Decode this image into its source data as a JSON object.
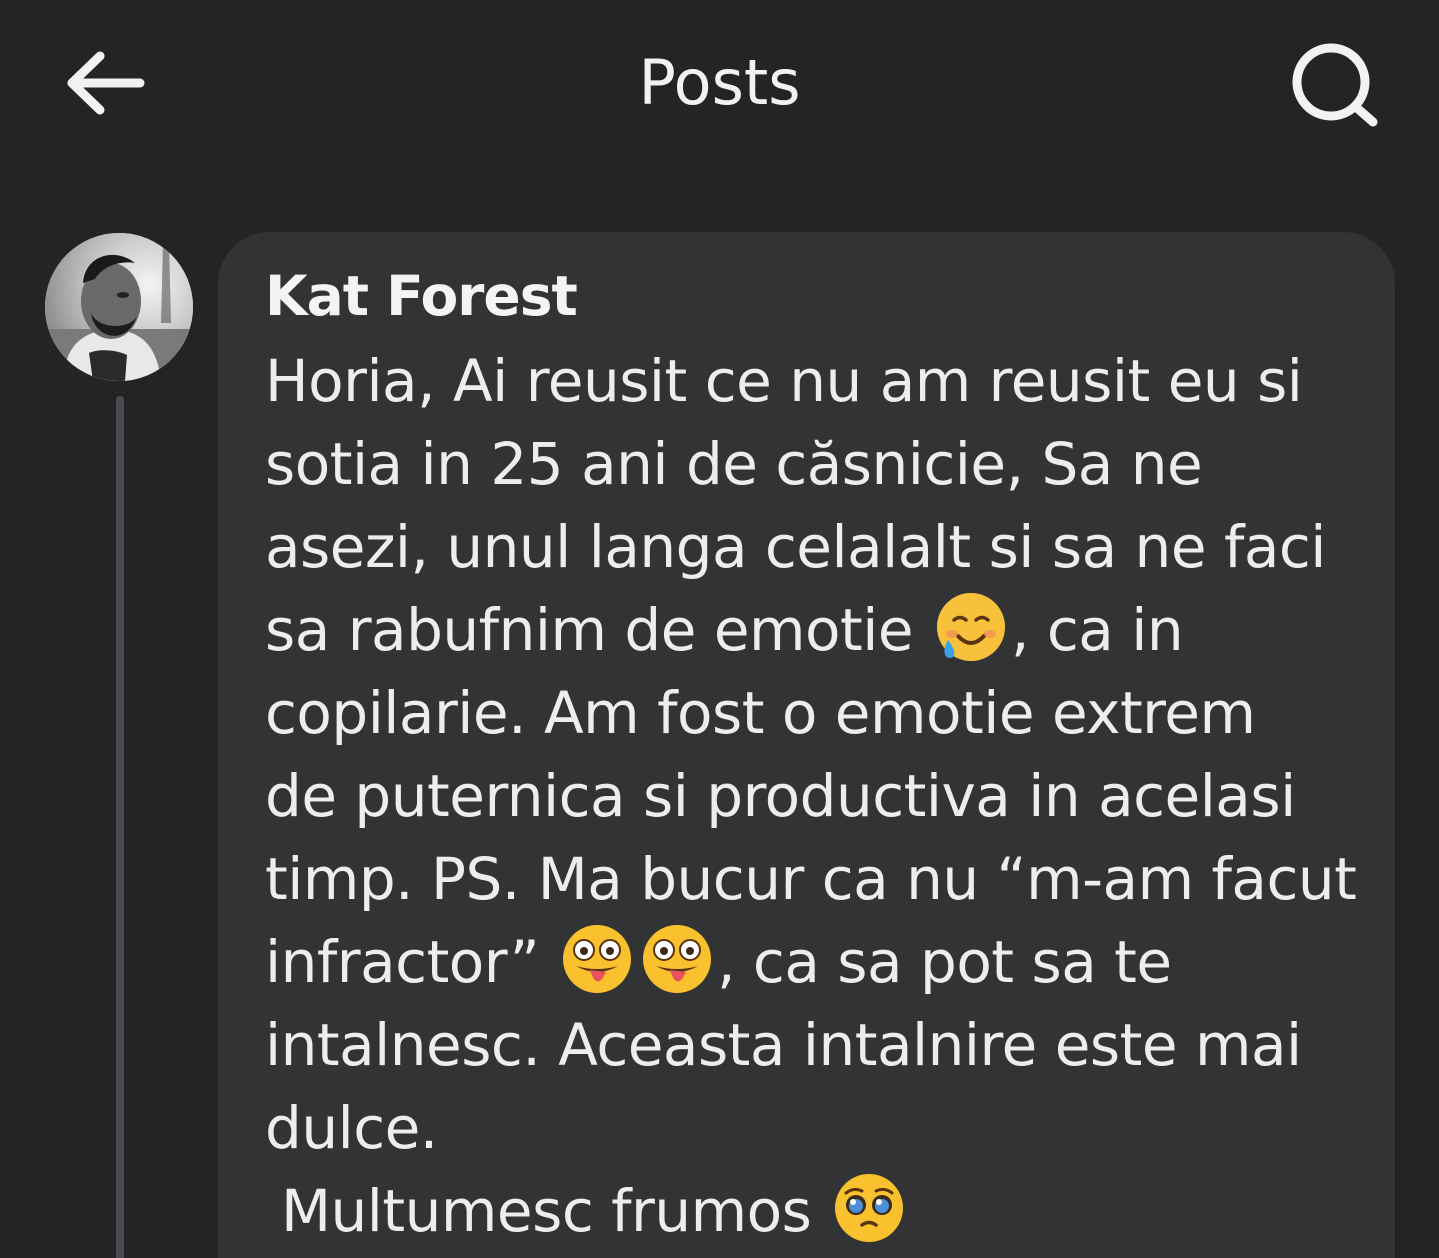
{
  "header": {
    "title": "Posts",
    "back_icon": "arrow-left-icon",
    "search_icon": "search-icon"
  },
  "post": {
    "author": "Kat Forest",
    "lines": [
      "Horia, Ai reusit ce nu am reusit eu si",
      "sotia in 25 ani de căsnicie, Sa ne",
      "asezi, unul langa celalalt si sa ne faci",
      "sa rabufnim de emotie",
      ", ca in",
      "copilarie. Am fost o emotie extrem",
      "de puternica si productiva in acelasi",
      "timp. PS. Ma bucur ca nu “m-am facut",
      "infractor”",
      ", ca sa pot sa te",
      "intalnesc. Aceasta intalnire este mai",
      "dulce.",
      "Multumesc frumos"
    ],
    "emojis": {
      "emotion": "smiling-face-with-tear-icon",
      "goofy": "zany-face-icon",
      "pleading": "pleading-face-icon"
    }
  },
  "colors": {
    "background": "#232426",
    "bubble": "#323335",
    "text": "#ecedef",
    "thread_line": "#4b4c4f"
  }
}
